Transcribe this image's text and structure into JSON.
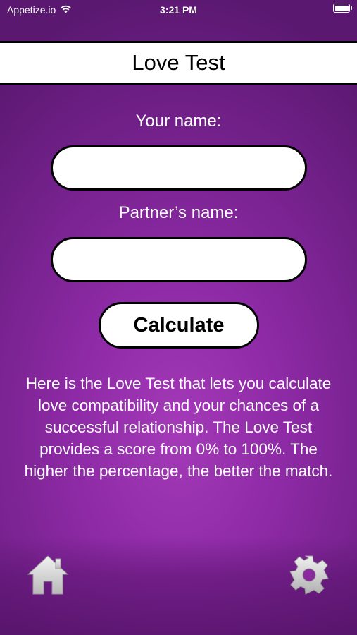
{
  "status_bar": {
    "carrier": "Appetize.io",
    "time": "3:21 PM",
    "wifi_icon": "wifi-icon",
    "battery_icon": "battery-icon"
  },
  "header": {
    "title": "Love Test"
  },
  "form": {
    "your_name_label": "Your name:",
    "your_name_value": "",
    "partner_name_label": "Partner’s name:",
    "partner_name_value": "",
    "calculate_label": "Calculate"
  },
  "description": "Here is the Love Test that lets you calculate love compatibility and your chances of a successful relationship. The Love Test provides a score from 0% to 100%. The higher the percentage, the better the match.",
  "bottom_bar": {
    "home_icon": "home-icon",
    "settings_icon": "gear-icon"
  },
  "colors": {
    "background_center": "#a43ab8",
    "background_edge": "#5a1870",
    "field_fill": "#ffffff",
    "border": "#000000"
  }
}
